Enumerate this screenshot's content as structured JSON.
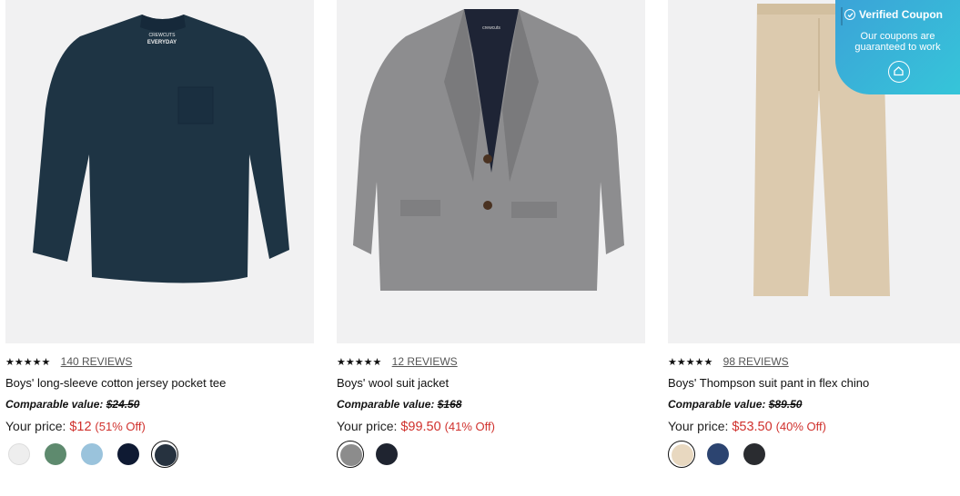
{
  "products": [
    {
      "name": "Boys' long-sleeve cotton jersey pocket tee",
      "stars": "★★★★★",
      "reviews": "140 REVIEWS",
      "comparable_label": "Comparable value:",
      "comparable_price": "$24.50",
      "your_price_label": "Your price:",
      "price": "$12",
      "discount": "(51% Off)",
      "image": "navy-long-sleeve-tee",
      "tag_text": [
        "CREWCUTS",
        "EVERYDAY"
      ],
      "swatches": [
        {
          "color": "#eeeeee",
          "selected": false
        },
        {
          "color": "#5e8a6e",
          "selected": false
        },
        {
          "color": "#9ac3dc",
          "selected": false
        },
        {
          "color": "#0f1a33",
          "selected": false
        },
        {
          "color": "#26323f",
          "selected": true
        }
      ]
    },
    {
      "name": "Boys' wool suit jacket",
      "stars": "★★★★★",
      "reviews": "12 REVIEWS",
      "comparable_label": "Comparable value:",
      "comparable_price": "$168",
      "your_price_label": "Your price:",
      "price": "$99.50",
      "discount": "(41% Off)",
      "image": "grey-wool-suit-jacket",
      "tag_text": [
        "crewcuts"
      ],
      "swatches": [
        {
          "color": "#8c8c8c",
          "selected": true
        },
        {
          "color": "#1f2430",
          "selected": false
        }
      ]
    },
    {
      "name": "Boys' Thompson suit pant in flex chino",
      "stars": "★★★★★",
      "reviews": "98 REVIEWS",
      "comparable_label": "Comparable value:",
      "comparable_price": "$89.50",
      "your_price_label": "Your price:",
      "price": "$53.50",
      "discount": "(40% Off)",
      "image": "khaki-chino-pant",
      "tag_text": [],
      "swatches": [
        {
          "color": "#e8d8c0",
          "selected": true
        },
        {
          "color": "#2c4470",
          "selected": false
        },
        {
          "color": "#2a2c30",
          "selected": false
        }
      ]
    }
  ],
  "coupon": {
    "title": "Verified Coupon",
    "subtitle_line1": "Our coupons are",
    "subtitle_line2": "guaranteed to work",
    "icon": "check-circle-icon",
    "logo_icon": "extension-logo-icon"
  },
  "colors": {
    "sale_red": "#d0312d",
    "image_bg": "#f1f1f2",
    "coupon_gradient": [
      "#3ba3d8",
      "#36c5d9"
    ]
  }
}
